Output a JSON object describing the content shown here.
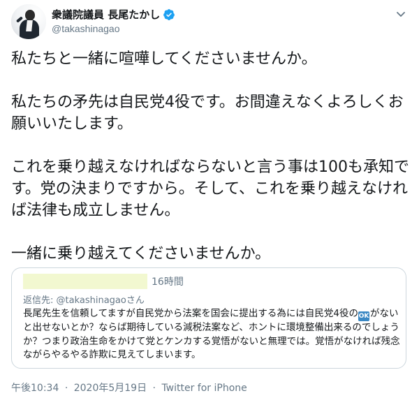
{
  "author": {
    "display_name": "衆議院議員 長尾たかし",
    "handle": "@takashinagao",
    "verified": true
  },
  "icons": {
    "verified": "verified-badge-icon",
    "menu": "chevron-down-icon"
  },
  "colors": {
    "verified_blue": "#1da1f2",
    "secondary_text": "#657786",
    "border": "#ccd6dd",
    "redaction_highlight": "#f2f8d0"
  },
  "tweet": {
    "paragraphs": [
      "私たちと一緒に喧嘩してくださいませんか。",
      "私たちの矛先は自民党4役です。お間違えなくよろしくお願いいたします。",
      "これを乗り越えなければならないと言う事は100も承知です。党の決まりですから。そして、これを乗り越えなければ法律も成立しません。",
      "一緒に乗り越えてくださいませんか。"
    ]
  },
  "quoted": {
    "time": "16時間",
    "reply_to": "返信先: @takashinagaoさん",
    "text_before_emoji": "長尾先生を信頼してますが自民党から法案を国会に提出する為には自民党4役の",
    "emoji_label": "OK",
    "text_after_emoji": "がないと出せないとか？ならば期待している減税法案など、ホントに環境整備出来るのでしょうか？つまり政治生命をかけて党とケンカする覚悟がないと無理では。覚悟がなければ残念ながらやるやる詐欺に見えてしまいます。"
  },
  "footer": {
    "time": "午後10:34",
    "separator": "·",
    "date": "2020年5月19日",
    "source": "Twitter for iPhone"
  }
}
